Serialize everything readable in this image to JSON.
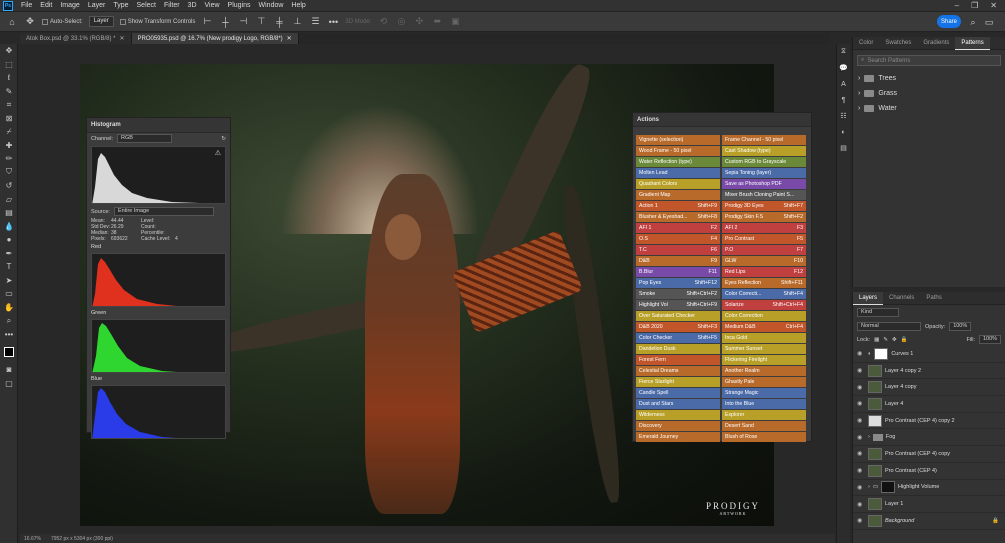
{
  "menu": [
    "File",
    "Edit",
    "Image",
    "Layer",
    "Type",
    "Select",
    "Filter",
    "3D",
    "View",
    "Plugins",
    "Window",
    "Help"
  ],
  "options": {
    "auto_select": "Auto-Select:",
    "layer_select": "Layer",
    "show_transform": "Show Transform Controls",
    "mode_3d": "3D Mode:",
    "share": "Share"
  },
  "tabs": [
    {
      "label": "Atok Box.psd @ 33.1% (RGB/8) *"
    },
    {
      "label": "PRO05935.psd @ 16.7% (New prodigy Logo, RGB/8*)"
    }
  ],
  "status": {
    "zoom": "16.67%",
    "doc": "7952 px x 5304 px (300 ppi)"
  },
  "watermark": {
    "main": "PRODIGY",
    "sub": "ARTWORK"
  },
  "histogram": {
    "title": "Histogram",
    "channel_label": "Channel:",
    "channel": "RGB",
    "source_label": "Source:",
    "source": "Entire Image",
    "stats": [
      [
        "Mean:",
        "44.44",
        "Level:",
        ""
      ],
      [
        "Std Dev:",
        "26.29",
        "Count:",
        ""
      ],
      [
        "Median:",
        "38",
        "Percentile:",
        ""
      ],
      [
        "Pixels:",
        "693622",
        "Cache Level:",
        "4"
      ]
    ],
    "red": "Red",
    "green": "Green",
    "blue": "Blue"
  },
  "actions_panel": {
    "title": "Actions"
  },
  "actions": [
    [
      "Vignette (selection)",
      "",
      "#b86a2a"
    ],
    [
      "Frame Channel - 50 pixel",
      "",
      "#b86a2a"
    ],
    [
      "Wood Frame - 50 pixel",
      "",
      "#b86a2a"
    ],
    [
      "Cast Shadow (type)",
      "",
      "#b8a028"
    ],
    [
      "Water Reflection (type)",
      "",
      "#6a8a3a"
    ],
    [
      "Custom RGB to Grayscale",
      "",
      "#6a8a3a"
    ],
    [
      "Molten Lead",
      "",
      "#4a6aa8"
    ],
    [
      "Sepia Toning (layer)",
      "",
      "#4a6aa8"
    ],
    [
      "Quadrant Colors",
      "",
      "#b8a028"
    ],
    [
      "Save as Photoshop PDF",
      "",
      "#7a4aa8"
    ],
    [
      "Gradient Map",
      "",
      "#b86a2a"
    ],
    [
      "Mixer Brush Cloning Paint S...",
      "",
      "#555555"
    ],
    [
      "Action 1",
      "Shift+F9",
      "#c0562a"
    ],
    [
      "Prodigy 3D Eyes",
      "Shift+F7",
      "#c0562a"
    ],
    [
      "Blusher & Eyeshad...",
      "Shift+F8",
      "#b86a2a"
    ],
    [
      "Prodigy Skin F.S",
      "Shift+F2",
      "#b86a2a"
    ],
    [
      "AFI 1",
      "F2",
      "#c04040"
    ],
    [
      "AFI 2",
      "F3",
      "#c04040"
    ],
    [
      "O.S",
      "F4",
      "#c0562a"
    ],
    [
      "Pro Contrast",
      "F5",
      "#c0562a"
    ],
    [
      "T.C",
      "F6",
      "#c04040"
    ],
    [
      "P.O",
      "F7",
      "#c04040"
    ],
    [
      "D&B",
      "F9",
      "#b86a2a"
    ],
    [
      "GLW",
      "F10",
      "#b86a2a"
    ],
    [
      "B.Blur",
      "F11",
      "#7a4aa8"
    ],
    [
      "Red Lips",
      "F12",
      "#c04040"
    ],
    [
      "Pop Eyes",
      "Shift+F12",
      "#4a6aa8"
    ],
    [
      "Eyes Reflection",
      "Shift+F11",
      "#b86a2a"
    ],
    [
      "Smoke",
      "Shift+Ctrl+F2",
      "#555555"
    ],
    [
      "Color Correcti...",
      "Shift+F4",
      "#4a6aa8"
    ],
    [
      "Highlight Vol",
      "Shift+Ctrl+F9",
      "#555555"
    ],
    [
      "Solarize",
      "Shift+Ctrl+F4",
      "#c04040"
    ],
    [
      "Over Saturated Checker",
      "",
      "#b8a028"
    ],
    [
      "Color Correction",
      "",
      "#b8a028"
    ],
    [
      "D&B 2020",
      "Shift+F3",
      "#c0562a"
    ],
    [
      "Medium D&B",
      "Ctrl+F4",
      "#c0562a"
    ],
    [
      "Color Checker",
      "Shift+F5",
      "#4a6aa8"
    ],
    [
      "Inca Gold",
      "",
      "#b8a028"
    ],
    [
      "Dandelion Dusk",
      "",
      "#b8a028"
    ],
    [
      "Summer Sunset",
      "",
      "#b8a028"
    ],
    [
      "Forest Fern",
      "",
      "#c0562a"
    ],
    [
      "Flickering Firelight",
      "",
      "#b8a028"
    ],
    [
      "Celestial Dreams",
      "",
      "#b86a2a"
    ],
    [
      "Another Realm",
      "",
      "#b86a2a"
    ],
    [
      "Fierce Starlight",
      "",
      "#b8a028"
    ],
    [
      "Ghastly Pale",
      "",
      "#b86a2a"
    ],
    [
      "Candle Spell",
      "",
      "#4a6aa8"
    ],
    [
      "Strange Magic",
      "",
      "#4a6aa8"
    ],
    [
      "Dust and Stars",
      "",
      "#4a6aa8"
    ],
    [
      "Into the Blue",
      "",
      "#4a6aa8"
    ],
    [
      "Wilderness",
      "",
      "#b8a028"
    ],
    [
      "Explorer",
      "",
      "#b8a028"
    ],
    [
      "Discovery",
      "",
      "#b86a2a"
    ],
    [
      "Desert Sand",
      "",
      "#b86a2a"
    ],
    [
      "Emerald Journey",
      "",
      "#b86a2a"
    ],
    [
      "Blush of Rose",
      "",
      "#b86a2a"
    ]
  ],
  "right_top": {
    "tabs": [
      "Color",
      "Swatches",
      "Gradients",
      "Patterns"
    ],
    "search_placeholder": "Search Patterns",
    "groups": [
      "Trees",
      "Grass",
      "Water"
    ]
  },
  "layers_panel": {
    "tabs": [
      "Layers",
      "Channels",
      "Paths"
    ],
    "kind": "Kind",
    "blend": "Normal",
    "opacity_label": "Opacity:",
    "opacity": "100%",
    "lock_label": "Lock:",
    "fill_label": "Fill:",
    "fill": "100%",
    "layers": [
      "Curves 1",
      "Layer 4 copy 2",
      "Layer 4 copy",
      "Layer 4",
      "Pro Contrast (CEP 4) copy 2",
      "Fog",
      "Pro Contrast (CEP 4) copy",
      "Pro Contrast (CEP 4)",
      "Highlight Volume",
      "Layer 1",
      "Background"
    ]
  }
}
